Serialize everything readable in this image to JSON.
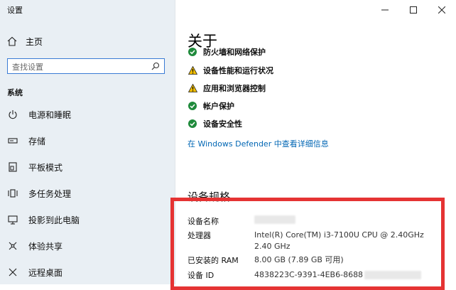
{
  "window": {
    "title": "设置"
  },
  "sidebar": {
    "home_label": "主页",
    "search_placeholder": "查找设置",
    "section_label": "系统",
    "items": [
      {
        "label": "电源和睡眠",
        "icon": "power-icon"
      },
      {
        "label": "存储",
        "icon": "storage-icon"
      },
      {
        "label": "平板模式",
        "icon": "tablet-mode-icon"
      },
      {
        "label": "多任务处理",
        "icon": "multitasking-icon"
      },
      {
        "label": "投影到此电脑",
        "icon": "project-icon"
      },
      {
        "label": "体验共享",
        "icon": "shared-experiences-icon"
      },
      {
        "label": "远程桌面",
        "icon": "remote-desktop-icon"
      }
    ]
  },
  "main": {
    "title": "关于",
    "security_status": [
      {
        "label": "防火墙和网络保护",
        "status": "ok",
        "icon": "green-check-icon"
      },
      {
        "label": "设备性能和运行状况",
        "status": "warning",
        "icon": "warning-icon"
      },
      {
        "label": "应用和浏览器控制",
        "status": "warning",
        "icon": "warning-icon"
      },
      {
        "label": "帐户保护",
        "status": "ok",
        "icon": "green-check-icon"
      },
      {
        "label": "设备安全性",
        "status": "ok",
        "icon": "green-check-icon"
      }
    ],
    "defender_link": "在 Windows Defender 中查看详细信息",
    "specs_title": "设备规格",
    "specs": {
      "device_name_label": "设备名称",
      "processor_label": "处理器",
      "processor_value": "Intel(R) Core(TM) i3-7100U CPU @ 2.40GHz   2.40 GHz",
      "ram_label": "已安装的 RAM",
      "ram_value": "8.00 GB (7.89 GB 可用)",
      "device_id_label": "设备 ID",
      "device_id_value": "4838223C-9391-4EB6-8688"
    }
  },
  "colors": {
    "accent": "#0066b4",
    "ok": "#1f8a3b",
    "warning": "#f4c000",
    "highlight_box": "#e53333",
    "sidebar_bg": "#e9eff4"
  }
}
